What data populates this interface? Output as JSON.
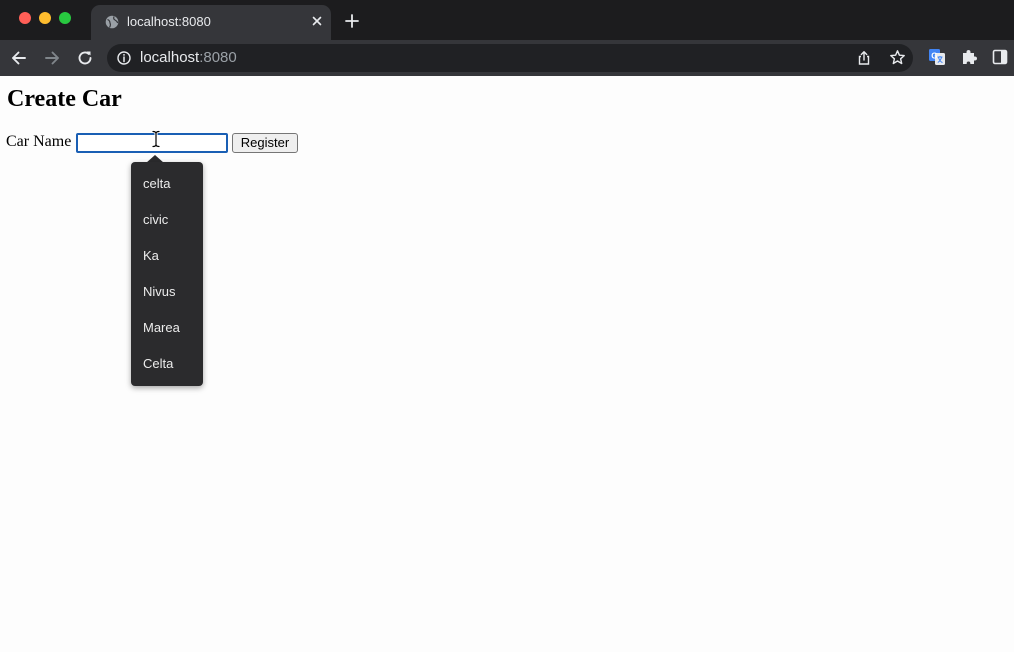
{
  "browser": {
    "tab_title": "localhost:8080",
    "url_host": "localhost",
    "url_port": ":8080"
  },
  "page": {
    "heading": "Create Car",
    "form": {
      "label": "Car Name",
      "input_value": "",
      "submit_label": "Register"
    },
    "datalist": {
      "options": [
        "celta",
        "civic",
        "Ka",
        "Nivus",
        "Marea",
        "Celta"
      ]
    }
  },
  "icons": {
    "tab_favicon": "globe-icon",
    "tab_close": "close-icon",
    "new_tab": "plus-icon",
    "back": "arrow-left-icon",
    "forward": "arrow-right-icon",
    "reload": "reload-icon",
    "site_info": "info-icon",
    "share": "share-icon",
    "bookmark": "star-icon",
    "translate_extension": "translate-icon",
    "extensions": "puzzle-icon",
    "side_panel": "side-panel-icon",
    "text_cursor": "ibeam-cursor-icon"
  },
  "colors": {
    "chrome_dark": "#202124",
    "tab_active": "#35363a",
    "input_focus": "#1a5fb4",
    "datalist_bg": "#2b2b2d"
  }
}
